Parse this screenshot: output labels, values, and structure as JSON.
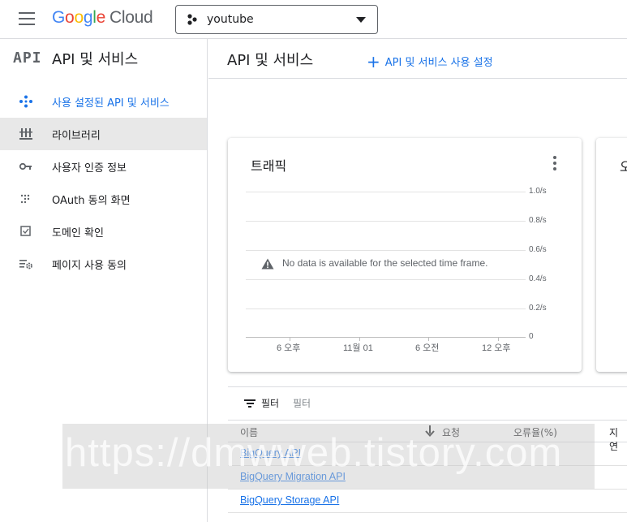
{
  "header": {
    "logo_letters": [
      "G",
      "o",
      "o",
      "g",
      "l",
      "e"
    ],
    "logo_product": "Cloud",
    "project_name": "youtube"
  },
  "sidebar": {
    "logo_text": "API",
    "title": "API 및 서비스",
    "items": [
      {
        "label": "사용 설정된 API 및 서비스",
        "icon": "diamond-dots-icon",
        "state": "active"
      },
      {
        "label": "라이브러리",
        "icon": "library-icon",
        "state": "selected"
      },
      {
        "label": "사용자 인증 정보",
        "icon": "key-icon",
        "state": "normal"
      },
      {
        "label": "OAuth 동의 화면",
        "icon": "grid-dots-icon",
        "state": "normal"
      },
      {
        "label": "도메인 확인",
        "icon": "checkbox-icon",
        "state": "normal"
      },
      {
        "label": "페이지 사용 동의",
        "icon": "list-gear-icon",
        "state": "normal"
      }
    ]
  },
  "main": {
    "title": "API 및 서비스",
    "enable_button": "API 및 서비스 사용 설정"
  },
  "traffic_card": {
    "title": "트래픽",
    "no_data": "No data is available for the selected time frame.",
    "y_ticks": [
      "1.0/s",
      "0.8/s",
      "0.6/s",
      "0.4/s",
      "0.2/s",
      "0"
    ],
    "x_ticks": [
      "6 오후",
      "11월 01",
      "6 오전",
      "12 오후"
    ]
  },
  "second_card": {
    "title_partial": "오"
  },
  "table": {
    "filter_label": "필터",
    "filter_placeholder": "필터",
    "columns": [
      "이름",
      "요청",
      "오류율(%)",
      "지연"
    ],
    "sort_icon": "arrow-down-icon",
    "rows": [
      "BigQuery API",
      "BigQuery Migration API",
      "BigQuery Storage API"
    ]
  },
  "watermark": "https://dmwweb.tistory.com",
  "colors": {
    "accent": "#1a73e8",
    "active_bg": "#e8e8e8",
    "border": "#dadce0"
  }
}
